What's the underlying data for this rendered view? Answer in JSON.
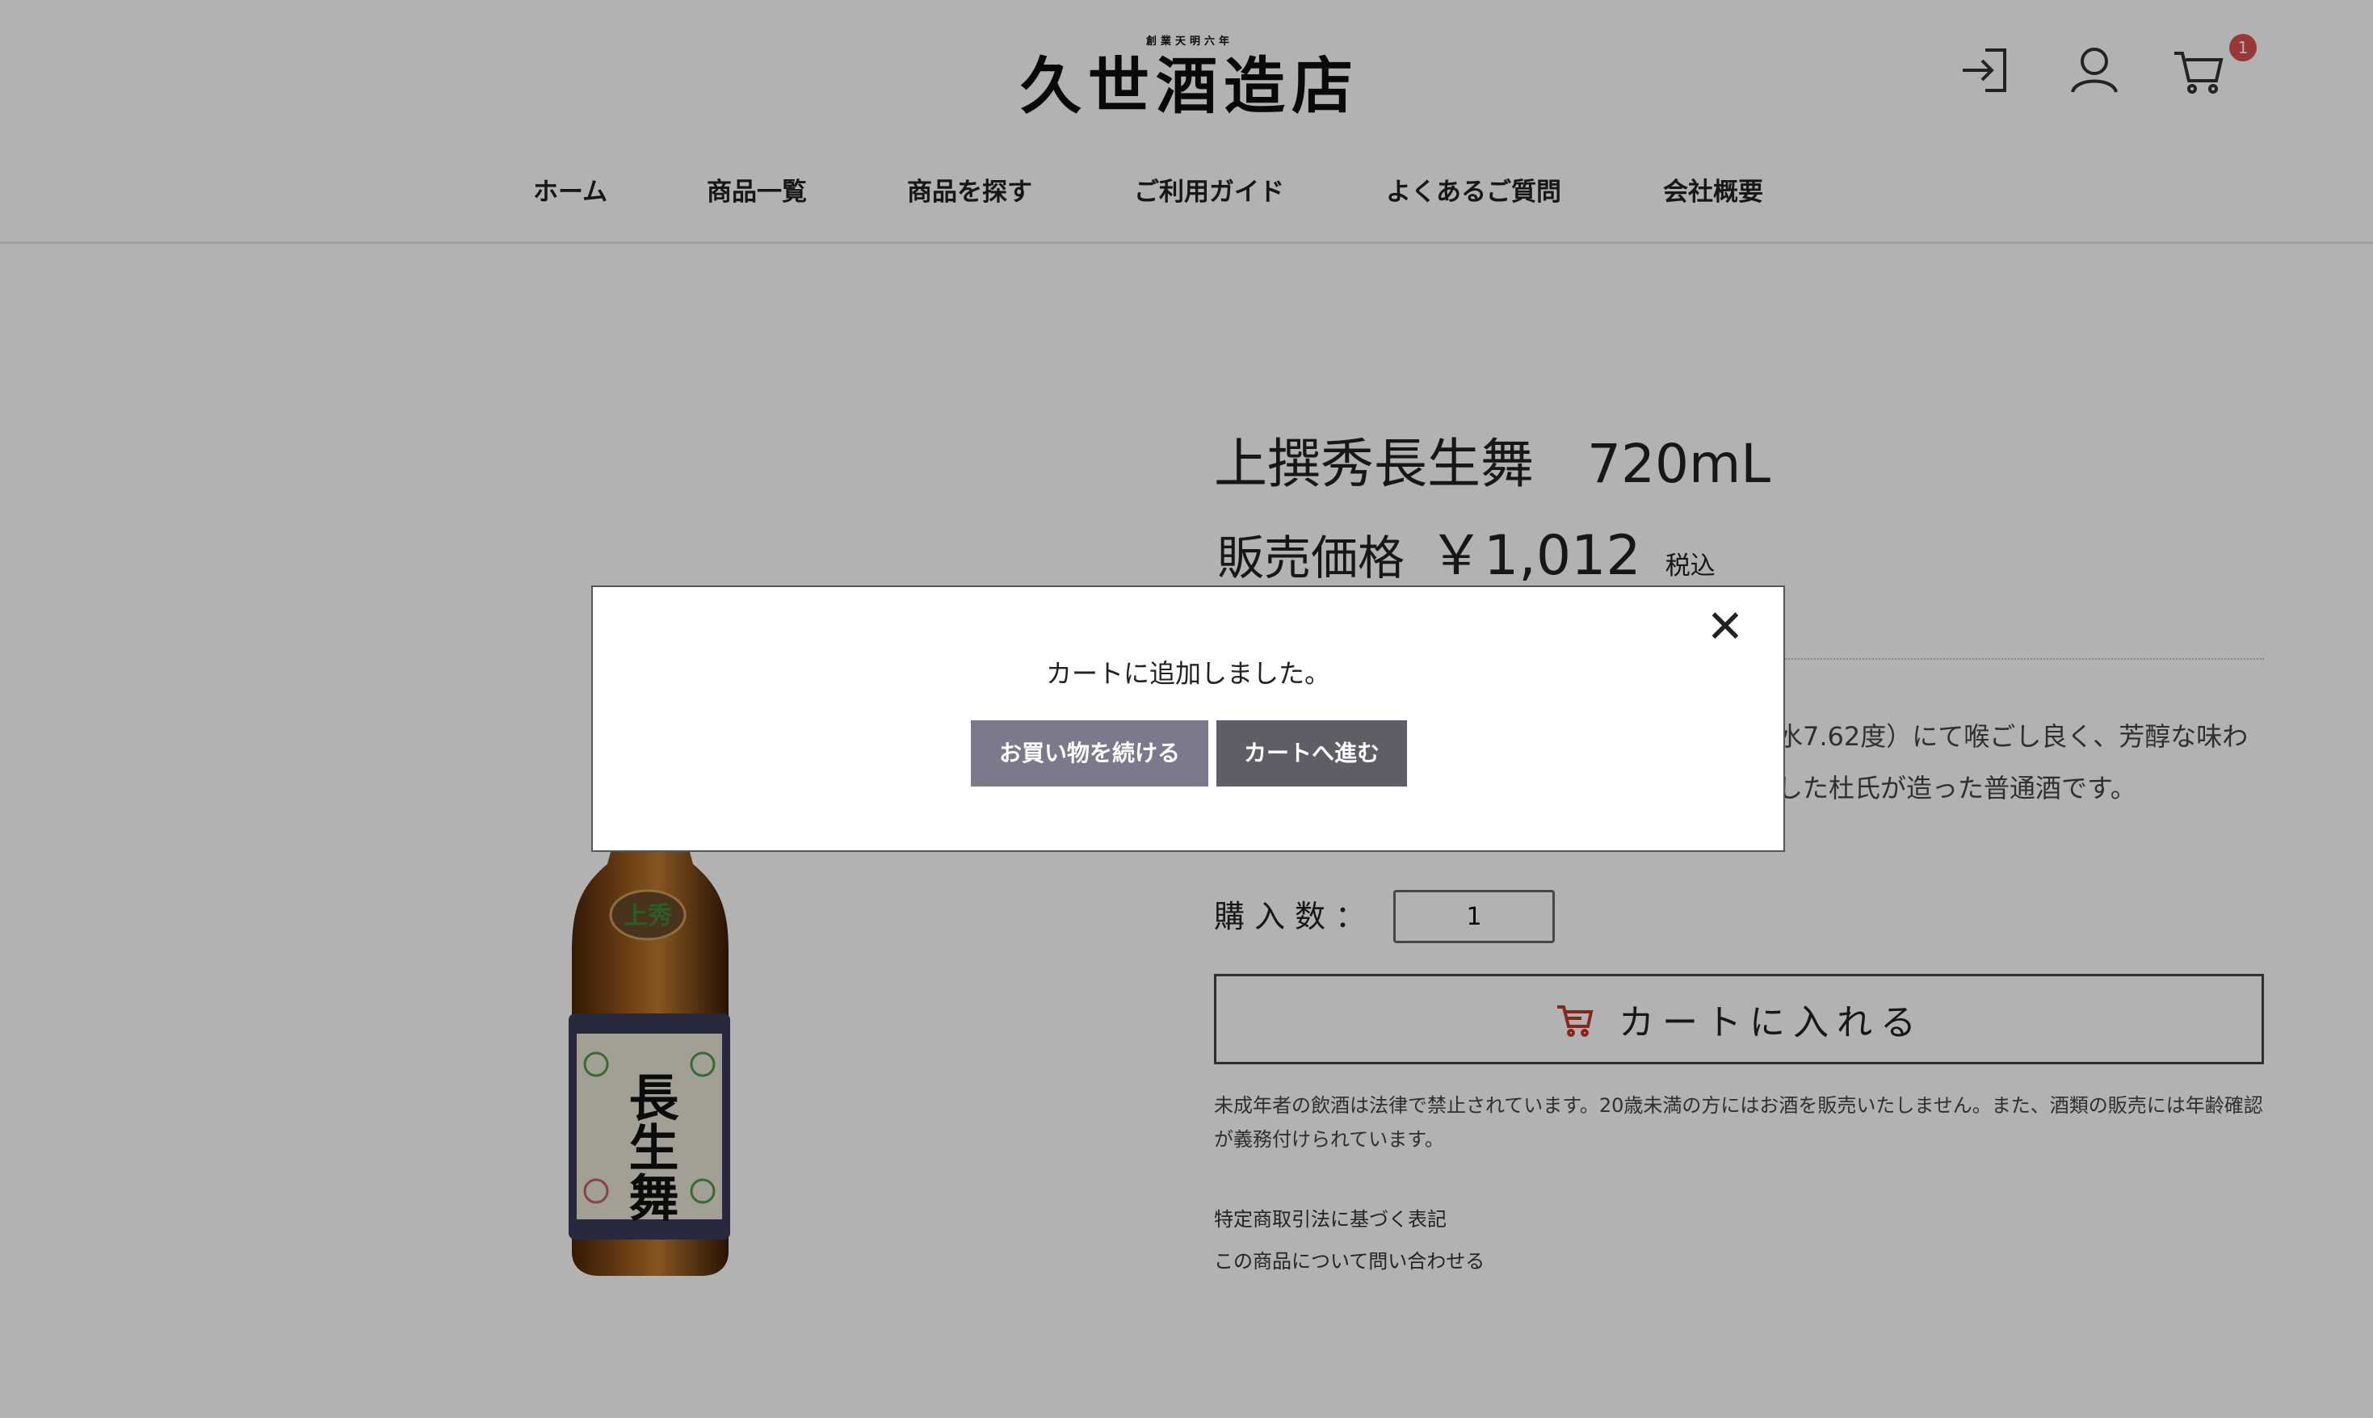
{
  "header": {
    "logo_sub": "創業天明六年",
    "logo_main": "久世酒造店",
    "cart_count": "1",
    "icons": [
      "login-icon",
      "user-icon",
      "cart-icon"
    ]
  },
  "nav": {
    "items": [
      "ホーム",
      "商品一覧",
      "商品を探す",
      "ご利用ガイド",
      "よくあるご質問",
      "会社概要"
    ]
  },
  "product": {
    "title": "上撰秀長生舞　720mL",
    "price_label": "販売価格",
    "price_value": "￥1,012",
    "tax_label": "税込",
    "description_line1": "水7.62度）にて喉ごし良く、芳醇な味わ",
    "description_line2": "した杜氏が造った普通酒です。",
    "qty_label": "購入数：",
    "qty_value": "1",
    "add_to_cart": "カートに入れる",
    "notice": "未成年者の飲酒は法律で禁止されています。20歳未満の方にはお酒を販売いたしません。また、酒類の販売には年齢確認が義務付けられています。",
    "link_legal": "特定商取引法に基づく表記",
    "link_inquiry": "この商品について問い合わせる",
    "label_brand": "長生舞",
    "label_top": "上秀"
  },
  "modal": {
    "message": "カートに追加しました。",
    "continue_label": "お買い物を続ける",
    "cart_label": "カートへ進む",
    "close_symbol": "✕"
  },
  "colors": {
    "overlay": "rgba(0,0,0,0.30)",
    "button_continue": "#7a7a8c",
    "button_cart": "#5e5e66",
    "badge": "#d9534f",
    "cart_icon_accent": "#c0392b"
  }
}
